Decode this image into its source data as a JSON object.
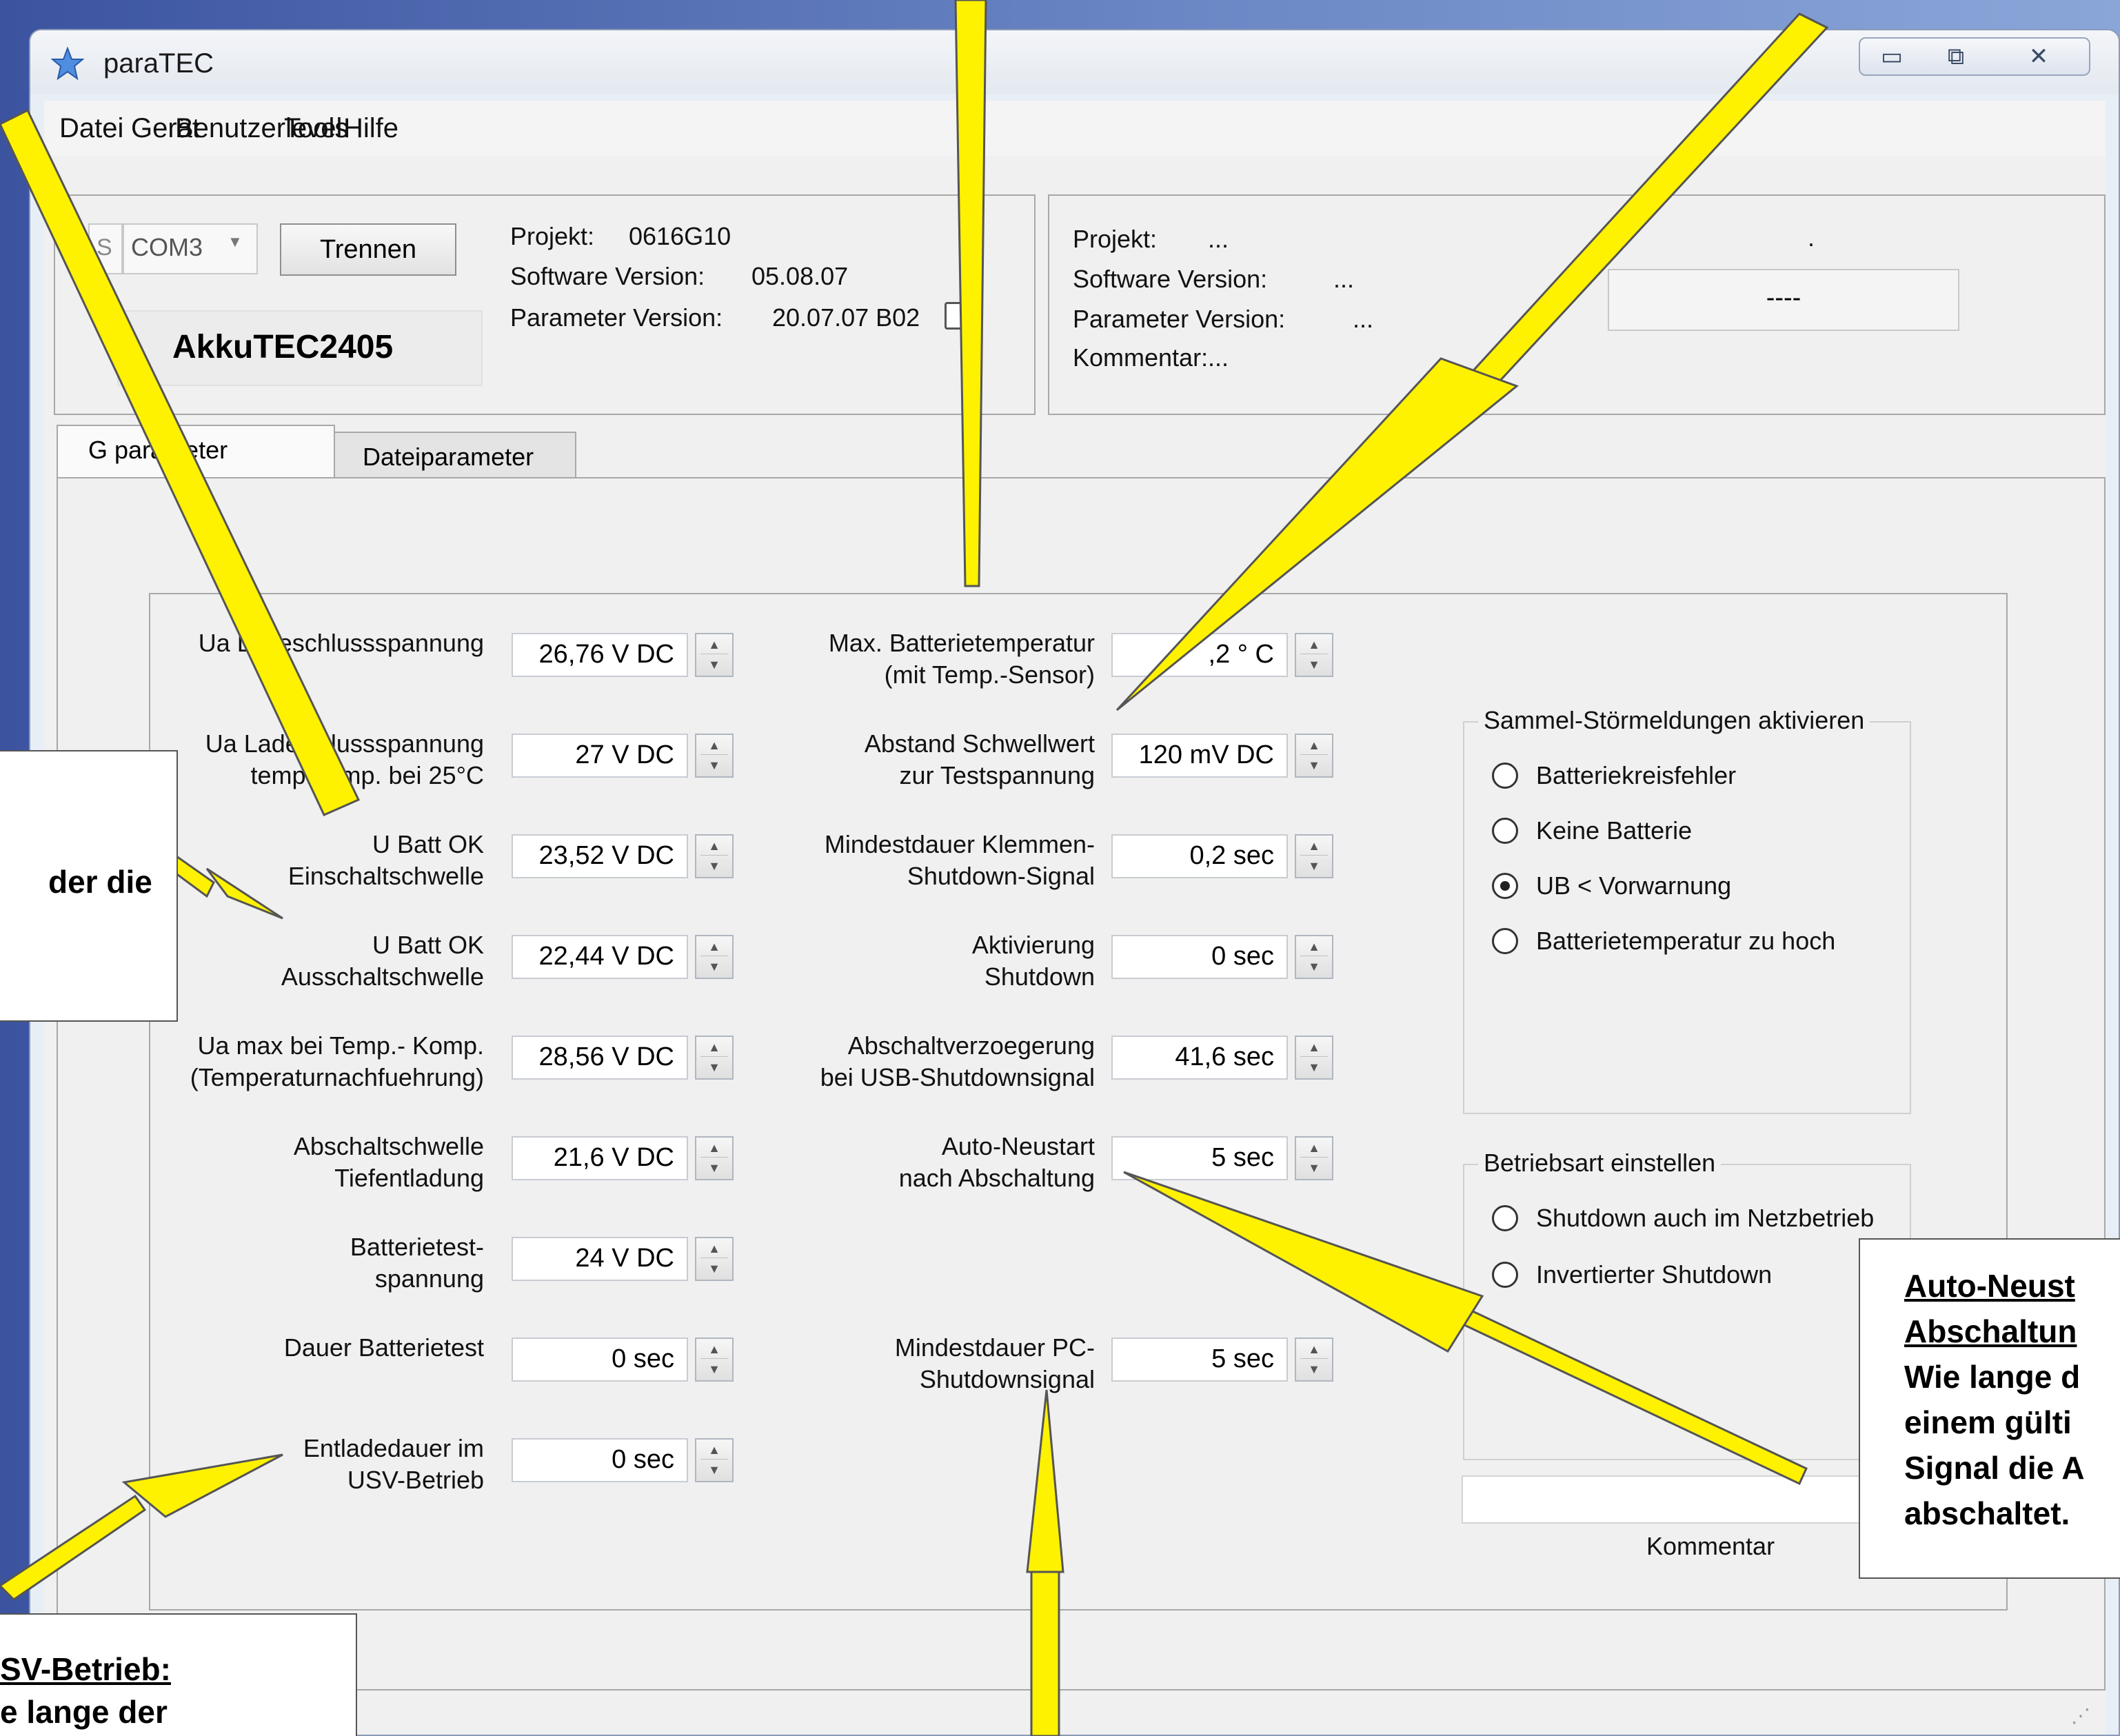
{
  "window": {
    "title": "paraTEC",
    "minimize": "▭",
    "maximize": "⧉",
    "close": "✕"
  },
  "icons": {
    "app": "star-icon",
    "grip": "resize-grip-icon"
  },
  "menu": [
    "Datei",
    "Gerät",
    "Benutzerlevel",
    "Tools",
    "Hilfe"
  ],
  "device": {
    "port_prefix": "S",
    "port": "COM3",
    "disconnect": "Trennen",
    "name": "AkkuTEC2405",
    "project_label": "Projekt:",
    "project_value": "0616G10",
    "software_label": "Software Version:",
    "software_value": "05.08.07",
    "param_label": "Parameter Version:",
    "param_value": "20.07.07 B02"
  },
  "file": {
    "project_label": "Projekt:",
    "project_value": "...",
    "software_label": "Software Version:",
    "software_value": "...",
    "param_label": "Parameter Version:",
    "param_value": "...",
    "comment_label": "Kommentar:",
    "comment_value": "...",
    "dot": ".",
    "status_value": "----"
  },
  "tabs": [
    "G   parameter",
    "Dateiparameter"
  ],
  "left_params": [
    {
      "label": "Ua La  eschlussspannung",
      "value": "26,76 V DC"
    },
    {
      "label": "Ua Ladesc lussspannung\ntemp.-k mp. bei 25°C",
      "value": "27 V DC"
    },
    {
      "label": "U Batt OK\nEinschaltschwelle",
      "value": "23,52 V DC"
    },
    {
      "label": "U Batt OK\nAusschaltschwelle",
      "value": "22,44 V DC"
    },
    {
      "label": "Ua max bei Temp.- Komp.\n(Temperaturnachfuehrung)",
      "value": "28,56 V DC"
    },
    {
      "label": "Abschaltschwelle\nTiefentladung",
      "value": "21,6 V DC"
    },
    {
      "label": "Batterietest-\nspannung",
      "value": "24 V DC"
    },
    {
      "label": "Dauer Batterietest",
      "value": "0 sec"
    },
    {
      "label": "Entladedauer im\nUSV-Betrieb",
      "value": "0 sec"
    }
  ],
  "mid_params": [
    {
      "label": "Max. Batterietemperatur\n(mit Temp.-Sensor)",
      "value": ",2 ° C"
    },
    {
      "label": "Abstand Schwellwert\nzur Testspannung",
      "value": "120 mV DC"
    },
    {
      "label": "Mindestdauer Klemmen-\nShutdown-Signal",
      "value": "0,2 sec"
    },
    {
      "label": "Aktivierung\nShutdown",
      "value": "0 sec"
    },
    {
      "label": "Abschaltverzoegerung\nbei USB-Shutdownsignal",
      "value": "41,6 sec"
    },
    {
      "label": "Auto-Neustart\nnach Abschaltung",
      "value": "5 sec"
    },
    {
      "label": "Mindestdauer PC-\nShutdownsignal",
      "value": "5  sec"
    }
  ],
  "alarms": {
    "title": "Sammel-Störmeldungen aktivieren",
    "options": [
      {
        "label": "Batteriekreisfehler",
        "checked": false
      },
      {
        "label": "Keine Batterie",
        "checked": false
      },
      {
        "label": "UB < Vorwarnung",
        "checked": true
      },
      {
        "label": "Batterietemperatur zu hoch",
        "checked": false
      }
    ]
  },
  "mode": {
    "title": "Betriebsart einstellen",
    "options": [
      {
        "label": "Shutdown auch im Netzbetrieb",
        "checked": false
      },
      {
        "label": "Invertierter Shutdown",
        "checked": false
      }
    ]
  },
  "comment": {
    "label": "Kommentar",
    "value": ""
  },
  "callouts": {
    "left_mid": "der die",
    "bottom_left_title": "SV-Betrieb:",
    "bottom_left_body": "e lange der",
    "right_title1": "Auto-Neust",
    "right_title2": "Abschaltun",
    "right_body": [
      "Wie lange d",
      "einem gülti",
      "Signal die A",
      "abschaltet."
    ]
  },
  "colors": {
    "arrow_fill": "#fff200",
    "arrow_stroke": "#555555",
    "window_bg": "#f0f0f0"
  }
}
